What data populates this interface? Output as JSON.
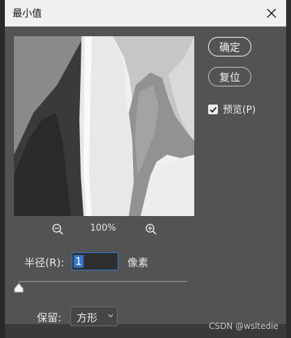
{
  "window": {
    "title": "最小值",
    "close_icon": "close-icon"
  },
  "preview": {
    "zoom_out_icon": "zoom-out-icon",
    "zoom_in_icon": "zoom-in-icon",
    "zoom_level": "100%"
  },
  "buttons": {
    "ok_label": "确定",
    "reset_label": "复位"
  },
  "preview_toggle": {
    "label": "预览(P)",
    "checked": true
  },
  "radius": {
    "label": "半径(R):",
    "value": "1",
    "unit": "像素",
    "slider_level": 0.0
  },
  "preserve": {
    "label": "保留:",
    "selected": "方形"
  },
  "watermark": "CSDN @wsltedie",
  "colors": {
    "dialog_bg": "#535353",
    "titlebar_bg": "#f0f0f0",
    "focus_blue": "#2f7ce0"
  }
}
